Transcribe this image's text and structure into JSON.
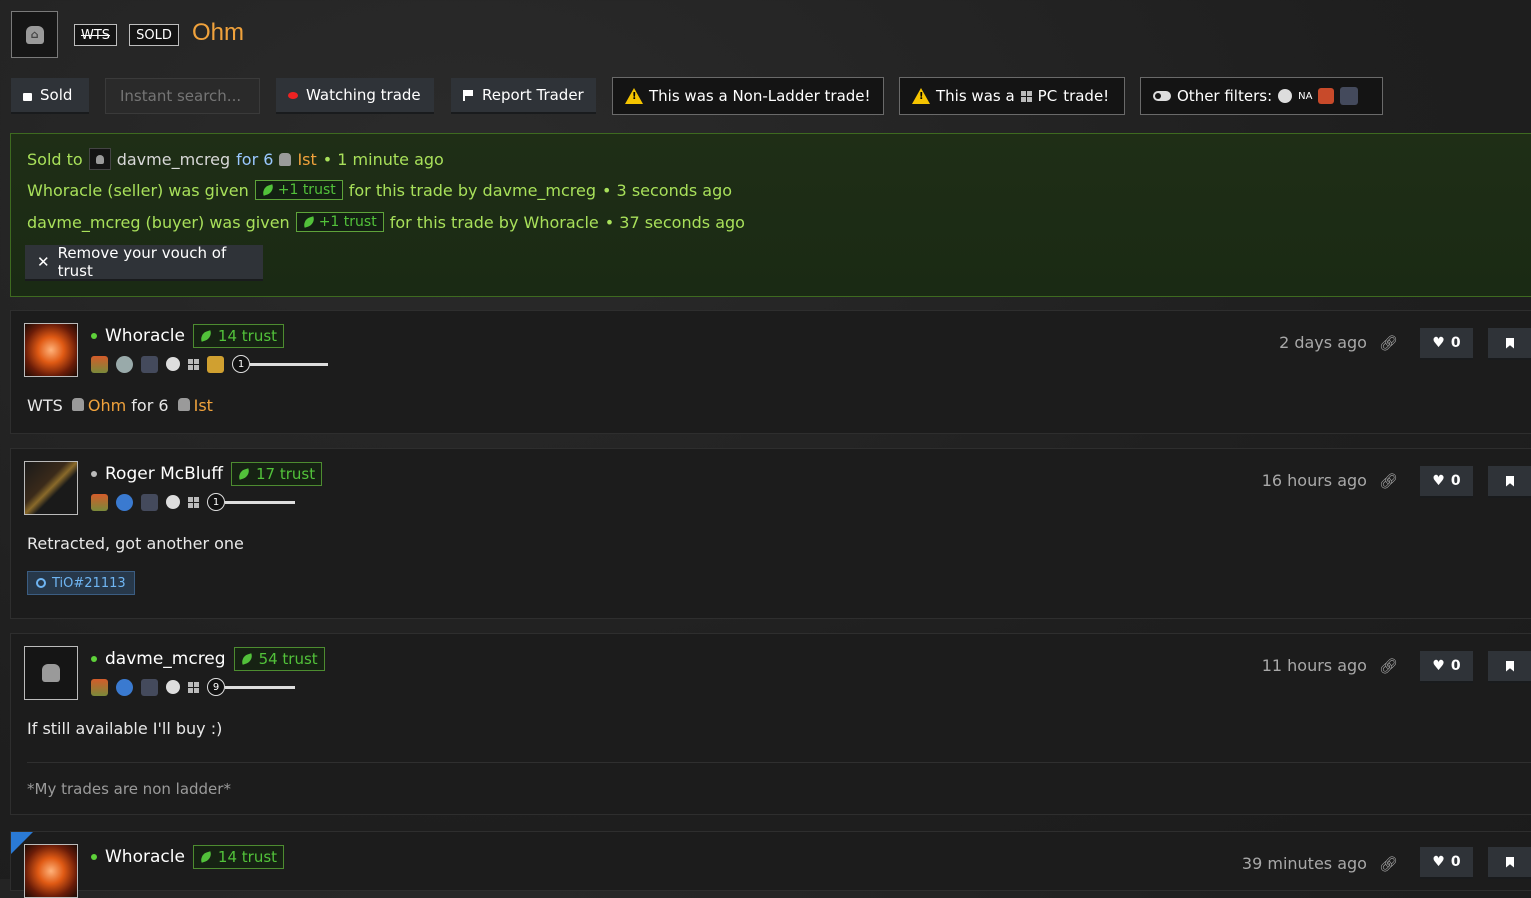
{
  "header": {
    "wts_tag": "WTS",
    "sold_tag": "SOLD",
    "title": "Ohm"
  },
  "toolbar": {
    "sold_label": "Sold",
    "search_placeholder": "Instant search...",
    "watch_label": "Watching trade",
    "report_label": "Report Trader",
    "ladder_prefix": "This was a ",
    "ladder_value": "Non-Ladder",
    "ladder_suffix": " trade!",
    "pc_prefix": "This was a",
    "pc_value": "PC",
    "pc_suffix": "trade!",
    "filters_label": "Other filters:",
    "region": "NA"
  },
  "sold_panel": {
    "sold_to_label": "Sold to",
    "buyer": "davme_mcreg",
    "for_text": "for 6",
    "price_item": "Ist",
    "sold_time": "• 1 minute ago",
    "line2_prefix": "Whoracle (seller) was given",
    "line2_badge": "+1 trust",
    "line2_suffix": "for this trade by davme_mcreg",
    "line2_time": "• 3 seconds ago",
    "line3_prefix": "davme_mcreg (buyer) was given",
    "line3_badge": "+1 trust",
    "line3_suffix": "for this trade by Whoracle",
    "line3_time": "• 37 seconds ago",
    "remove_label": "Remove your vouch of trust"
  },
  "posts": [
    {
      "user": "Whoracle",
      "trust": "14 trust",
      "level": "1",
      "time": "2 days ago",
      "likes": "0",
      "text_wts": "WTS",
      "text_item": "Ohm",
      "text_for": "for 6",
      "text_price": "Ist"
    },
    {
      "user": "Roger McBluff",
      "trust": "17 trust",
      "level": "1",
      "time": "16 hours ago",
      "likes": "0",
      "text": "Retracted, got another one",
      "battletag": "TiO#21113"
    },
    {
      "user": "davme_mcreg",
      "trust": "54 trust",
      "level": "9",
      "time": "11 hours ago",
      "likes": "0",
      "text": "If still available I'll buy :)",
      "signature": "*My trades are non ladder*"
    },
    {
      "user": "Whoracle",
      "trust": "14 trust",
      "time": "39 minutes ago",
      "likes": "0"
    }
  ],
  "colors": {
    "accent_gold": "#f0a23c",
    "trust_green": "#52c23a",
    "sold_text": "#a8e05a",
    "battletag_blue": "#6fb5f2"
  }
}
